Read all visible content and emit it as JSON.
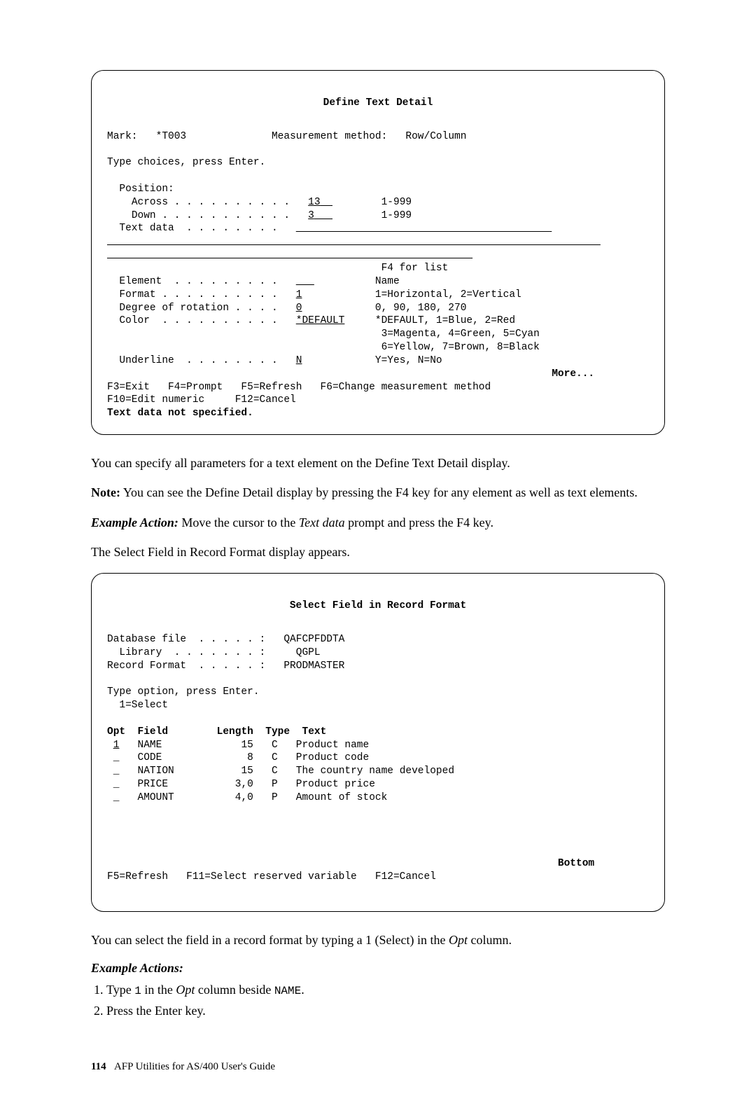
{
  "screen1": {
    "title": "Define Text Detail",
    "mark_label": "Mark:",
    "mark_value": "*T003",
    "method_label": "Measurement method:",
    "method_value": "Row/Column",
    "instructions": "Type choices, press Enter.",
    "position_label": "Position:",
    "across_label": "Across . . . . . . . . . .",
    "across_value": "13",
    "across_range": "1-999",
    "down_label": "Down . . . . . . . . . . .",
    "down_value": "3",
    "down_range": "1-999",
    "textdata_label": "Text data  . . . . . . . .",
    "element_label": "Element  . . . . . . . . .",
    "element_value": "",
    "element_hint1": "F4 for list",
    "element_hint2": "Name",
    "format_label": "Format . . . . . . . . . .",
    "format_value": "1",
    "format_hint": "1=Horizontal, 2=Vertical",
    "rotation_label": "Degree of rotation . . . .",
    "rotation_value": "0",
    "rotation_hint": "0, 90, 180, 270",
    "color_label": "Color  . . . . . . . . . .",
    "color_value": "*DEFAULT",
    "color_hint1": "*DEFAULT, 1=Blue, 2=Red",
    "color_hint2": "3=Magenta, 4=Green, 5=Cyan",
    "color_hint3": "6=Yellow, 7=Brown, 8=Black",
    "underline_label": "Underline  . . . . . . . .",
    "underline_value": "N",
    "underline_hint": "Y=Yes, N=No",
    "more": "More...",
    "fkeys1": "F3=Exit   F4=Prompt   F5=Refresh   F6=Change measurement method",
    "fkeys2": "F10=Edit numeric     F12=Cancel",
    "error": "Text data not specified."
  },
  "para1": "You can specify all parameters for a text element on the Define Text Detail display.",
  "note_label": "Note:",
  "note_body": "You can see the Define Detail display by pressing the F4 key for any element as well as text elements.",
  "example_action_label": "Example Action:",
  "example_action_body_before": "Move the cursor to the ",
  "example_action_textdata": "Text data",
  "example_action_body_after": " prompt and press the F4 key.",
  "para2": "The Select Field in Record Format display appears.",
  "screen2": {
    "title": "Select Field in Record Format",
    "db_label": "Database file  . . . . . :",
    "db_value": "QAFCPFDDTA",
    "lib_label": "Library  . . . . . . . :",
    "lib_value": "QGPL",
    "rf_label": "Record Format  . . . . . :",
    "rf_value": "PRODMASTER",
    "instructions": "Type option, press Enter.",
    "select_opt": "1=Select",
    "headers": {
      "opt": "Opt",
      "field": "Field",
      "length": "Length",
      "type": "Type",
      "text": "Text"
    },
    "rows": [
      {
        "opt": "1",
        "field": "NAME",
        "length": "15",
        "type": "C",
        "text": "Product name"
      },
      {
        "opt": "_",
        "field": "CODE",
        "length": "8",
        "type": "C",
        "text": "Product code"
      },
      {
        "opt": "_",
        "field": "NATION",
        "length": "15",
        "type": "C",
        "text": "The country name developed"
      },
      {
        "opt": "_",
        "field": "PRICE",
        "length": "3,0",
        "type": "P",
        "text": "Product price"
      },
      {
        "opt": "_",
        "field": "AMOUNT",
        "length": "4,0",
        "type": "P",
        "text": "Amount of stock"
      }
    ],
    "bottom": "Bottom",
    "fkeys": "F5=Refresh   F11=Select reserved variable   F12=Cancel"
  },
  "para3_before": "You can select the field in a record format by typing a 1 (Select) in the ",
  "para3_opt": "Opt",
  "para3_after": " column.",
  "example_actions_heading": "Example Actions:",
  "step1_a": "Type ",
  "step1_code": "1",
  "step1_b": " in the ",
  "step1_opt": "Opt",
  "step1_c": " column beside ",
  "step1_name": "NAME",
  "step1_d": ".",
  "step2": "Press the Enter key.",
  "footer": {
    "page": "114",
    "book": "AFP Utilities for AS/400 User's Guide"
  }
}
